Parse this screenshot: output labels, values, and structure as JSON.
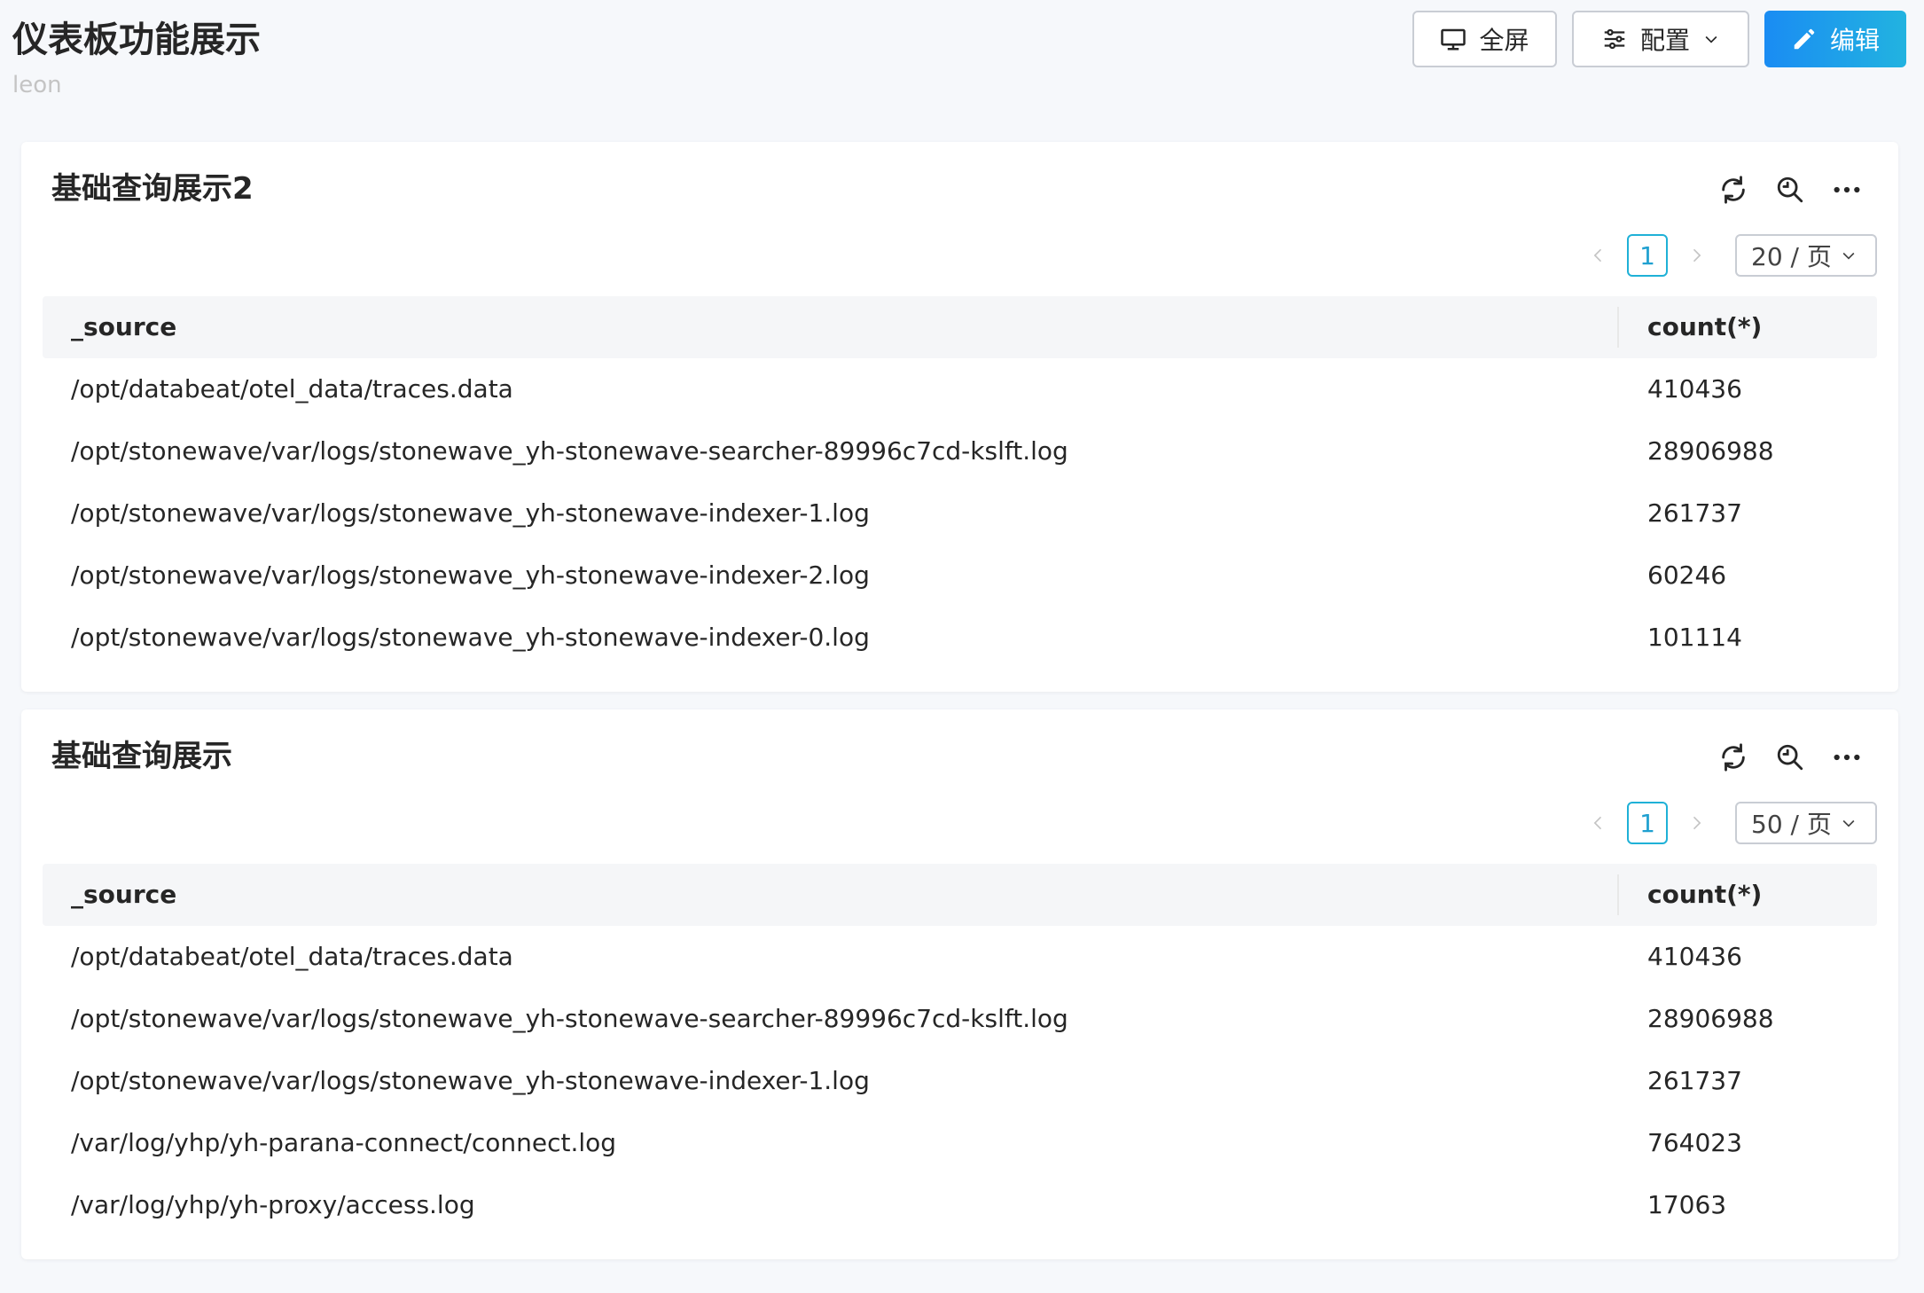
{
  "header": {
    "title": "仪表板功能展示",
    "subtitle": "leon",
    "fullscreen_label": "全屏",
    "config_label": "配置",
    "edit_label": "编辑"
  },
  "colors": {
    "accent": "#1fb1d7",
    "edit_gradient_start": "#1a8cf3",
    "edit_gradient_end": "#22b3e0",
    "background": "#f6f8fb"
  },
  "panels": [
    {
      "title": "基础查询展示2",
      "pager": {
        "current_page": "1",
        "page_size": "20 / 页"
      },
      "columns": [
        "_source",
        "count(*)"
      ],
      "rows": [
        {
          "source": "/opt/databeat/otel_data/traces.data",
          "count": "410436"
        },
        {
          "source": "/opt/stonewave/var/logs/stonewave_yh-stonewave-searcher-89996c7cd-kslft.log",
          "count": "28906988"
        },
        {
          "source": "/opt/stonewave/var/logs/stonewave_yh-stonewave-indexer-1.log",
          "count": "261737"
        },
        {
          "source": "/opt/stonewave/var/logs/stonewave_yh-stonewave-indexer-2.log",
          "count": "60246"
        },
        {
          "source": "/opt/stonewave/var/logs/stonewave_yh-stonewave-indexer-0.log",
          "count": "101114"
        }
      ]
    },
    {
      "title": "基础查询展示",
      "pager": {
        "current_page": "1",
        "page_size": "50 / 页"
      },
      "columns": [
        "_source",
        "count(*)"
      ],
      "rows": [
        {
          "source": "/opt/databeat/otel_data/traces.data",
          "count": "410436"
        },
        {
          "source": "/opt/stonewave/var/logs/stonewave_yh-stonewave-searcher-89996c7cd-kslft.log",
          "count": "28906988"
        },
        {
          "source": "/opt/stonewave/var/logs/stonewave_yh-stonewave-indexer-1.log",
          "count": "261737"
        },
        {
          "source": "/var/log/yhp/yh-parana-connect/connect.log",
          "count": "764023"
        },
        {
          "source": "/var/log/yhp/yh-proxy/access.log",
          "count": "17063"
        }
      ]
    }
  ]
}
